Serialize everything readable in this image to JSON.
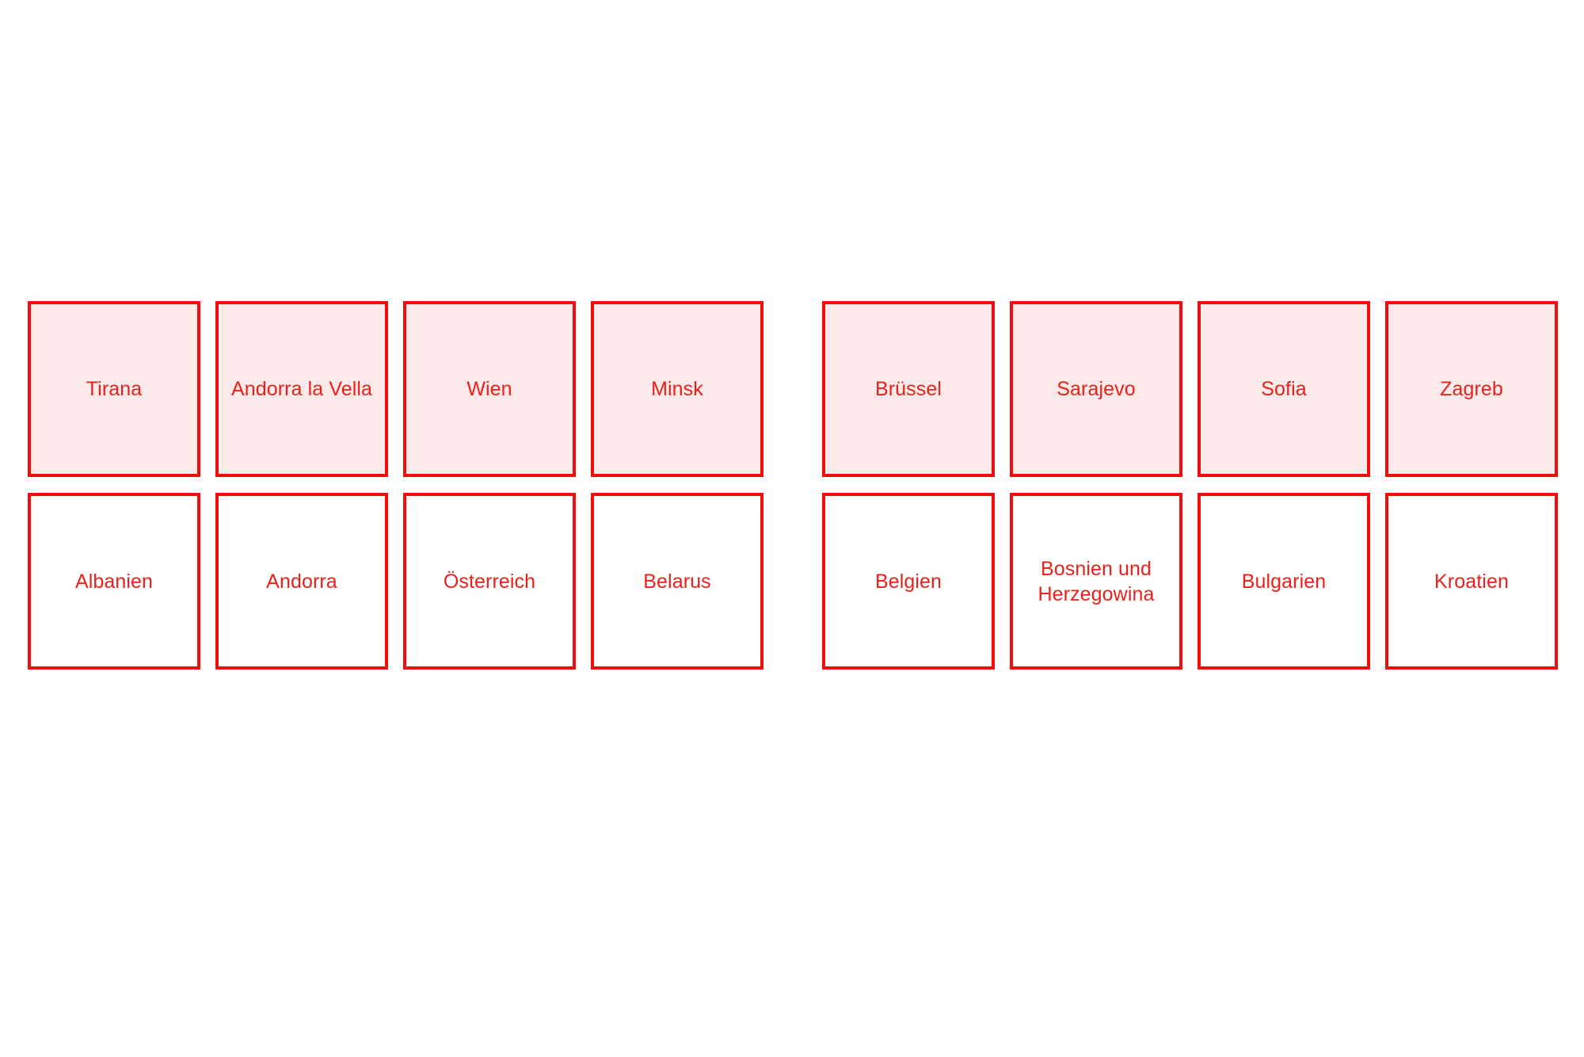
{
  "page": {
    "background_color": "#ffffff",
    "accent_color": "#f40d0d",
    "card_fill_color": "#fce9e9",
    "text_color": "#ea211b"
  },
  "groups": [
    {
      "id": "group-left",
      "pairs": [
        {
          "capital": "Tirana",
          "country": "Albanien"
        },
        {
          "capital": "Andorra la Vella",
          "country": "Andorra"
        },
        {
          "capital": "Wien",
          "country": "Österreich"
        },
        {
          "capital": "Minsk",
          "country": "Belarus"
        }
      ]
    },
    {
      "id": "group-right",
      "pairs": [
        {
          "capital": "Brüssel",
          "country": "Belgien"
        },
        {
          "capital": "Sarajevo",
          "country": "Bosnien und\nHerzegowina"
        },
        {
          "capital": "Sofia",
          "country": "Bulgarien"
        },
        {
          "capital": "Zagreb",
          "country": "Kroatien"
        }
      ]
    }
  ]
}
